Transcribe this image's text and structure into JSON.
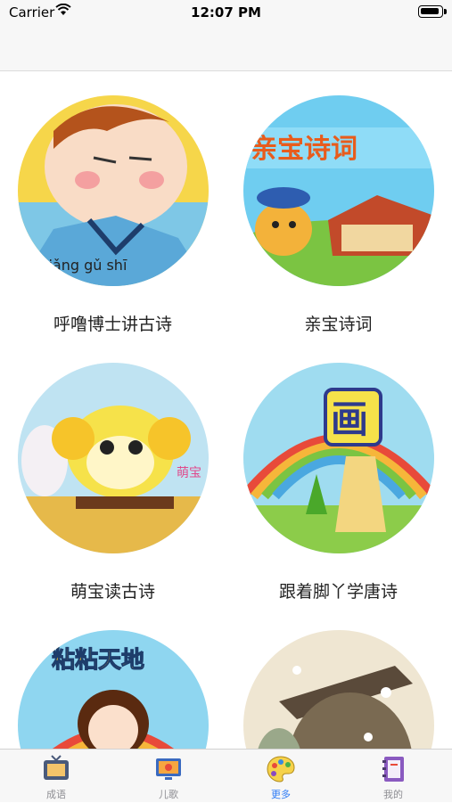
{
  "status_bar": {
    "carrier": "Carrier",
    "time": "12:07 PM"
  },
  "grid": [
    {
      "label": "呼噜博士讲古诗",
      "art_text": "jiǎng gǔ shī"
    },
    {
      "label": "亲宝诗词",
      "art_text": "亲宝诗词"
    },
    {
      "label": "萌宝读古诗",
      "art_text": "萌宝"
    },
    {
      "label": "跟着脚丫学唐诗",
      "art_text": "画"
    },
    {
      "label": "",
      "art_text": "粘粘天地"
    },
    {
      "label": "",
      "art_text": ""
    }
  ],
  "tab_bar": [
    {
      "label": "成语",
      "icon": "tv-icon",
      "active": false
    },
    {
      "label": "儿歌",
      "icon": "monitor-icon",
      "active": false
    },
    {
      "label": "更多",
      "icon": "palette-icon",
      "active": true
    },
    {
      "label": "我的",
      "icon": "notebook-icon",
      "active": false
    }
  ],
  "colors": {
    "accent": "#2f7cf6",
    "inactive": "#8e8e93"
  }
}
